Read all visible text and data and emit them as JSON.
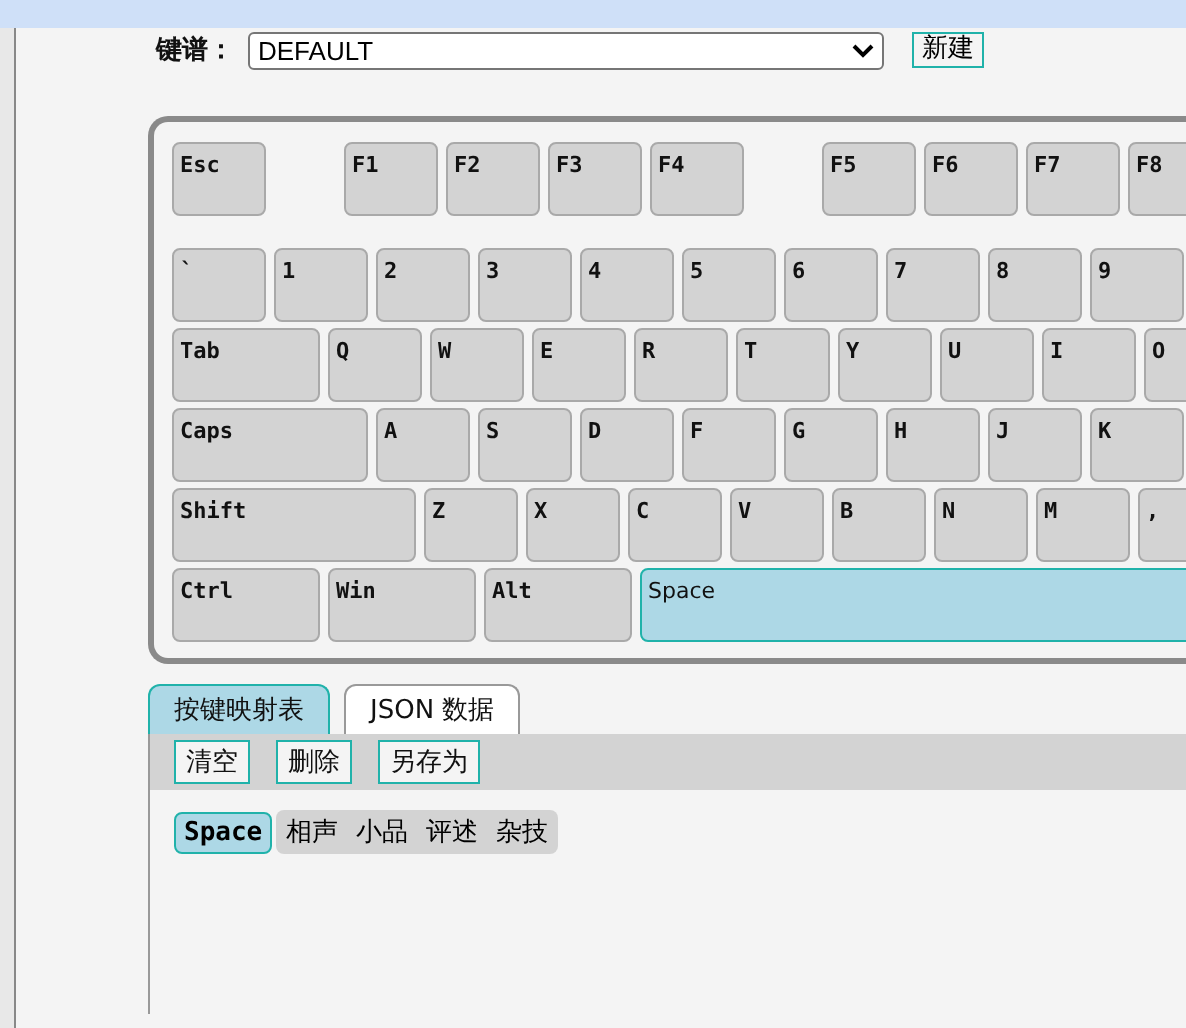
{
  "keymap": {
    "label": "键谱：",
    "value": "DEFAULT",
    "new_button": "新建"
  },
  "keyboard": {
    "rows": [
      {
        "groups": [
          [
            {
              "label": "Esc",
              "kind": "normal",
              "selected": false
            }
          ],
          [
            {
              "label": "F1",
              "kind": "normal",
              "selected": false
            },
            {
              "label": "F2",
              "kind": "normal",
              "selected": false
            },
            {
              "label": "F3",
              "kind": "normal",
              "selected": false
            },
            {
              "label": "F4",
              "kind": "normal",
              "selected": false
            }
          ],
          [
            {
              "label": "F5",
              "kind": "normal",
              "selected": false
            },
            {
              "label": "F6",
              "kind": "normal",
              "selected": false
            },
            {
              "label": "F7",
              "kind": "normal",
              "selected": false
            },
            {
              "label": "F8",
              "kind": "normal",
              "selected": false
            }
          ]
        ]
      },
      {
        "groups": [
          [
            {
              "label": "`",
              "kind": "normal",
              "selected": false
            },
            {
              "label": "1",
              "kind": "normal",
              "selected": false
            },
            {
              "label": "2",
              "kind": "normal",
              "selected": false
            },
            {
              "label": "3",
              "kind": "normal",
              "selected": false
            },
            {
              "label": "4",
              "kind": "normal",
              "selected": false
            },
            {
              "label": "5",
              "kind": "normal",
              "selected": false
            },
            {
              "label": "6",
              "kind": "normal",
              "selected": false
            },
            {
              "label": "7",
              "kind": "normal",
              "selected": false
            },
            {
              "label": "8",
              "kind": "normal",
              "selected": false
            },
            {
              "label": "9",
              "kind": "normal",
              "selected": false
            }
          ]
        ]
      },
      {
        "groups": [
          [
            {
              "label": "Tab",
              "kind": "wide",
              "selected": false
            },
            {
              "label": "Q",
              "kind": "normal",
              "selected": false
            },
            {
              "label": "W",
              "kind": "normal",
              "selected": false
            },
            {
              "label": "E",
              "kind": "normal",
              "selected": false
            },
            {
              "label": "R",
              "kind": "normal",
              "selected": false
            },
            {
              "label": "T",
              "kind": "normal",
              "selected": false
            },
            {
              "label": "Y",
              "kind": "normal",
              "selected": false
            },
            {
              "label": "U",
              "kind": "normal",
              "selected": false
            },
            {
              "label": "I",
              "kind": "normal",
              "selected": false
            },
            {
              "label": "O",
              "kind": "normal",
              "selected": false
            }
          ]
        ]
      },
      {
        "groups": [
          [
            {
              "label": "Caps",
              "kind": "caps",
              "selected": false
            },
            {
              "label": "A",
              "kind": "normal",
              "selected": false
            },
            {
              "label": "S",
              "kind": "normal",
              "selected": false
            },
            {
              "label": "D",
              "kind": "normal",
              "selected": false
            },
            {
              "label": "F",
              "kind": "normal",
              "selected": false
            },
            {
              "label": "G",
              "kind": "normal",
              "selected": false
            },
            {
              "label": "H",
              "kind": "normal",
              "selected": false
            },
            {
              "label": "J",
              "kind": "normal",
              "selected": false
            },
            {
              "label": "K",
              "kind": "normal",
              "selected": false
            }
          ]
        ]
      },
      {
        "groups": [
          [
            {
              "label": "Shift",
              "kind": "shift",
              "selected": false
            },
            {
              "label": "Z",
              "kind": "normal",
              "selected": false
            },
            {
              "label": "X",
              "kind": "normal",
              "selected": false
            },
            {
              "label": "C",
              "kind": "normal",
              "selected": false
            },
            {
              "label": "V",
              "kind": "normal",
              "selected": false
            },
            {
              "label": "B",
              "kind": "normal",
              "selected": false
            },
            {
              "label": "N",
              "kind": "normal",
              "selected": false
            },
            {
              "label": "M",
              "kind": "normal",
              "selected": false
            },
            {
              "label": ",",
              "kind": "normal",
              "selected": false
            }
          ]
        ]
      },
      {
        "groups": [
          [
            {
              "label": "Ctrl",
              "kind": "wide",
              "selected": false
            },
            {
              "label": "Win",
              "kind": "wide",
              "selected": false
            },
            {
              "label": "Alt",
              "kind": "wide",
              "selected": false
            },
            {
              "label": "Space",
              "kind": "space",
              "selected": true
            }
          ]
        ]
      }
    ]
  },
  "tabs": [
    {
      "label": "按键映射表",
      "selected": true
    },
    {
      "label": "JSON 数据",
      "selected": false
    }
  ],
  "toolbar": [
    "清空",
    "删除",
    "另存为"
  ],
  "mapping": {
    "key": "Space",
    "tags": [
      "相声",
      "小品",
      "评述",
      "杂技"
    ]
  }
}
